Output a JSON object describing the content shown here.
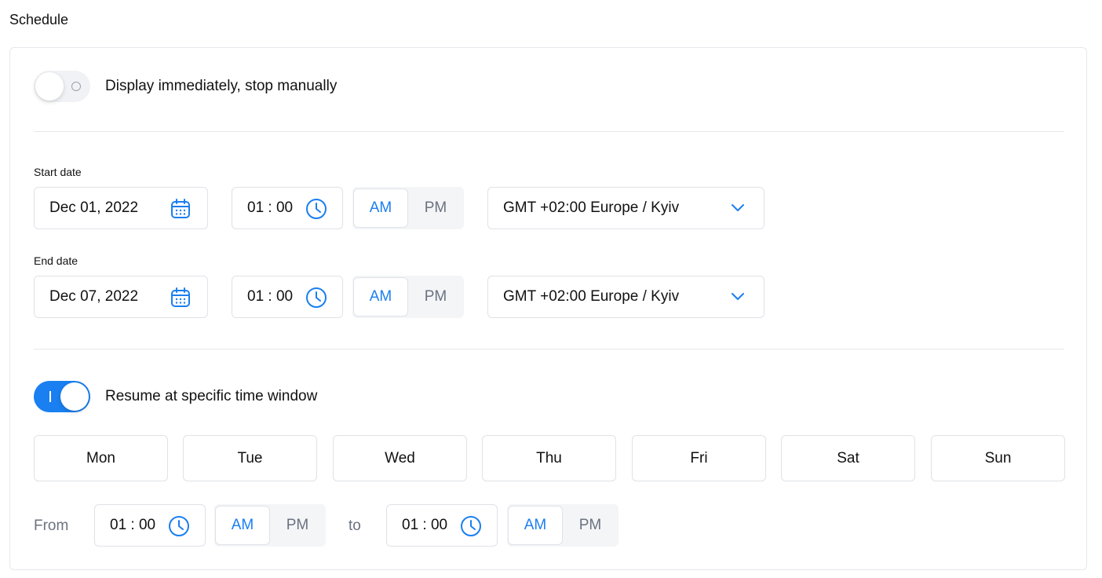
{
  "header": {
    "title": "Schedule"
  },
  "display_toggle": {
    "label": "Display immediately, stop manually",
    "on": false
  },
  "start": {
    "label": "Start date",
    "date": "Dec 01, 2022",
    "time": "01 : 00",
    "am": "AM",
    "pm": "PM",
    "timezone": "GMT +02:00 Europe / Kyiv"
  },
  "end": {
    "label": "End date",
    "date": "Dec 07, 2022",
    "time": "01 : 00",
    "am": "AM",
    "pm": "PM",
    "timezone": "GMT +02:00 Europe / Kyiv"
  },
  "resume_toggle": {
    "label": "Resume at specific time window",
    "on": true
  },
  "days": [
    "Mon",
    "Tue",
    "Wed",
    "Thu",
    "Fri",
    "Sat",
    "Sun"
  ],
  "window": {
    "from_label": "From",
    "from_time": "01 : 00",
    "from_am": "AM",
    "from_pm": "PM",
    "to_label": "to",
    "to_time": "01 : 00",
    "to_am": "AM",
    "to_pm": "PM"
  },
  "colors": {
    "accent": "#1a7ff0",
    "border": "#dfe2e7",
    "muted": "#6b7280"
  }
}
